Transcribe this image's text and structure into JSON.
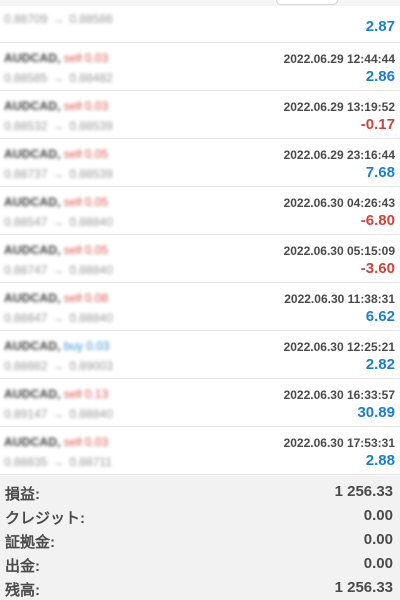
{
  "trades": [
    {
      "symbol": "AUDCAD",
      "side": "sell",
      "volume": "0.03",
      "open_price": "0.88709",
      "close_price": "0.88586",
      "time": "",
      "profit": "2.87"
    },
    {
      "symbol": "AUDCAD",
      "side": "sell",
      "volume": "0.03",
      "open_price": "0.88585",
      "close_price": "0.88482",
      "time": "2022.06.29 12:44:44",
      "profit": "2.86"
    },
    {
      "symbol": "AUDCAD",
      "side": "sell",
      "volume": "0.03",
      "open_price": "0.88532",
      "close_price": "0.88539",
      "time": "2022.06.29 13:19:52",
      "profit": "-0.17"
    },
    {
      "symbol": "AUDCAD",
      "side": "sell",
      "volume": "0.05",
      "open_price": "0.88737",
      "close_price": "0.88539",
      "time": "2022.06.29 23:16:44",
      "profit": "7.68"
    },
    {
      "symbol": "AUDCAD",
      "side": "sell",
      "volume": "0.05",
      "open_price": "0.88547",
      "close_price": "0.88840",
      "time": "2022.06.30 04:26:43",
      "profit": "-6.80"
    },
    {
      "symbol": "AUDCAD",
      "side": "sell",
      "volume": "0.05",
      "open_price": "0.88747",
      "close_price": "0.88840",
      "time": "2022.06.30 05:15:09",
      "profit": "-3.60"
    },
    {
      "symbol": "AUDCAD",
      "side": "sell",
      "volume": "0.08",
      "open_price": "0.88847",
      "close_price": "0.88840",
      "time": "2022.06.30 11:38:31",
      "profit": "6.62"
    },
    {
      "symbol": "AUDCAD",
      "side": "buy",
      "volume": "0.03",
      "open_price": "0.88882",
      "close_price": "0.89003",
      "time": "2022.06.30 12:25:21",
      "profit": "2.82"
    },
    {
      "symbol": "AUDCAD",
      "side": "sell",
      "volume": "0.13",
      "open_price": "0.89147",
      "close_price": "0.88840",
      "time": "2022.06.30 16:33:57",
      "profit": "30.89"
    },
    {
      "symbol": "AUDCAD",
      "side": "sell",
      "volume": "0.03",
      "open_price": "0.88835",
      "close_price": "0.88711",
      "time": "2022.06.30 17:53:31",
      "profit": "2.88"
    }
  ],
  "arrow": "→",
  "summary": {
    "profit_label": "損益:",
    "profit_value": "1 256.33",
    "credit_label": "クレジット:",
    "credit_value": "0.00",
    "deposit_label": "証拠金:",
    "deposit_value": "0.00",
    "withdrawal_label": "出金:",
    "withdrawal_value": "0.00",
    "balance_label": "残高:",
    "balance_value": "1 256.33"
  },
  "colors": {
    "positive": "#1a7fd0",
    "negative": "#d0433b",
    "sell": "#d9534f",
    "buy": "#3a8fd8"
  }
}
